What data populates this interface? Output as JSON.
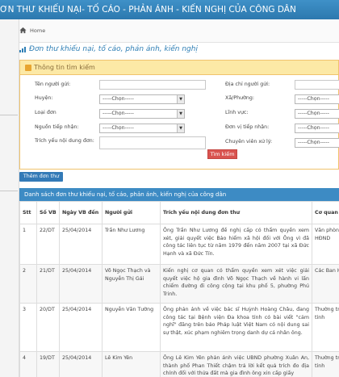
{
  "banner": {
    "title": "ƠN THƯ KHIẾU NẠI- TỐ CÁO - PHẢN ÁNH - KIẾN NGHỊ CỦA CÔNG DÂN"
  },
  "breadcrumb": {
    "home": "Home"
  },
  "page_title": "Đơn thư khiếu nại, tố cáo, phản ánh, kiến nghị",
  "search_panel": {
    "title": "Thông tin tìm kiếm",
    "labels": {
      "sender_name": "Tên người gửi:",
      "sender_address": "Địa chỉ người gửi:",
      "district": "Huyện:",
      "ward": "Xã/Phường:",
      "form_type": "Loại đơn",
      "field": "Lĩnh vực:",
      "receive_source": "Nguồn tiếp nhận:",
      "receiving_unit": "Đơn vị tiếp nhận:",
      "summary": "Trích yếu nội dung đơn:",
      "handler": "Chuyên viên xử lý:"
    },
    "select_placeholder": "-----Chọn-----",
    "search_button": "Tìm kiếm"
  },
  "add_button": "Thêm đơn thư",
  "list_title": "Danh sách đơn thư khiếu nại, tố cáo, phản ánh, kiến nghị của công dân",
  "table": {
    "headers": [
      "Stt",
      "Số VB",
      "Ngày VB đến",
      "Người gửi",
      "Trích yếu nội dung đơn thư",
      "Cơ quan tiếp nhận"
    ],
    "rows": [
      {
        "stt": "1",
        "so_vb": "22/DT",
        "ngay": "25/04/2014",
        "nguoi_gui": "Trần Như Lương",
        "trich_yeu": "Ông Trần Như Lương đề nghị cấp có thẩm quyền xem xét, giải quyết việc Bảo hiểm xã hội đối với Ông vì đã công tác liên tục từ năm 1979 đến năm 2007 tại xã Đức Hạnh và xã Đức Tín.",
        "co_quan": "Văn phòng ĐBQH & HĐND"
      },
      {
        "stt": "2",
        "so_vb": "21/DT",
        "ngay": "25/04/2014",
        "nguoi_gui": "Võ Ngọc Thạch và Nguyễn Thị Gái",
        "trich_yeu": "Kiến nghị cơ quan có thẩm quyền xem xét việc giải quyết việc hộ gia đình Võ Ngọc Thạch về hành vi lấn chiếm đường đi công cộng tại khu phố 5, phường Phú Trinh.",
        "co_quan": "Các Ban HĐND tỉnh"
      },
      {
        "stt": "3",
        "so_vb": "20/DT",
        "ngay": "25/04/2014",
        "nguoi_gui": "Nguyễn Văn Tường",
        "trich_yeu": "Ông phản ánh về việc bác sĩ Huỳnh Hoàng Châu, đang công tác tại Bệnh viện Đa khoa tỉnh có bài viết \"cảm nghĩ\" đăng trên báo Pháp luật Việt Nam có nội dung sai sự thật, xúc phạm nghiêm trọng danh dự cá nhân ông.",
        "co_quan": "Thường trực HĐND tỉnh"
      },
      {
        "stt": "4",
        "so_vb": "19/DT",
        "ngay": "25/04/2014",
        "nguoi_gui": "Lê Kim Yên",
        "trich_yeu": "Ông Lê Kim Yên phản ánh việc UBND phường Xuân An, thành phố Phan Thiết chậm trả lời kết quả trích đo địa chính đối với thửa đất mà gia đình ông xin cấp giấy",
        "co_quan": "Thường trực HĐND tỉnh"
      }
    ]
  }
}
